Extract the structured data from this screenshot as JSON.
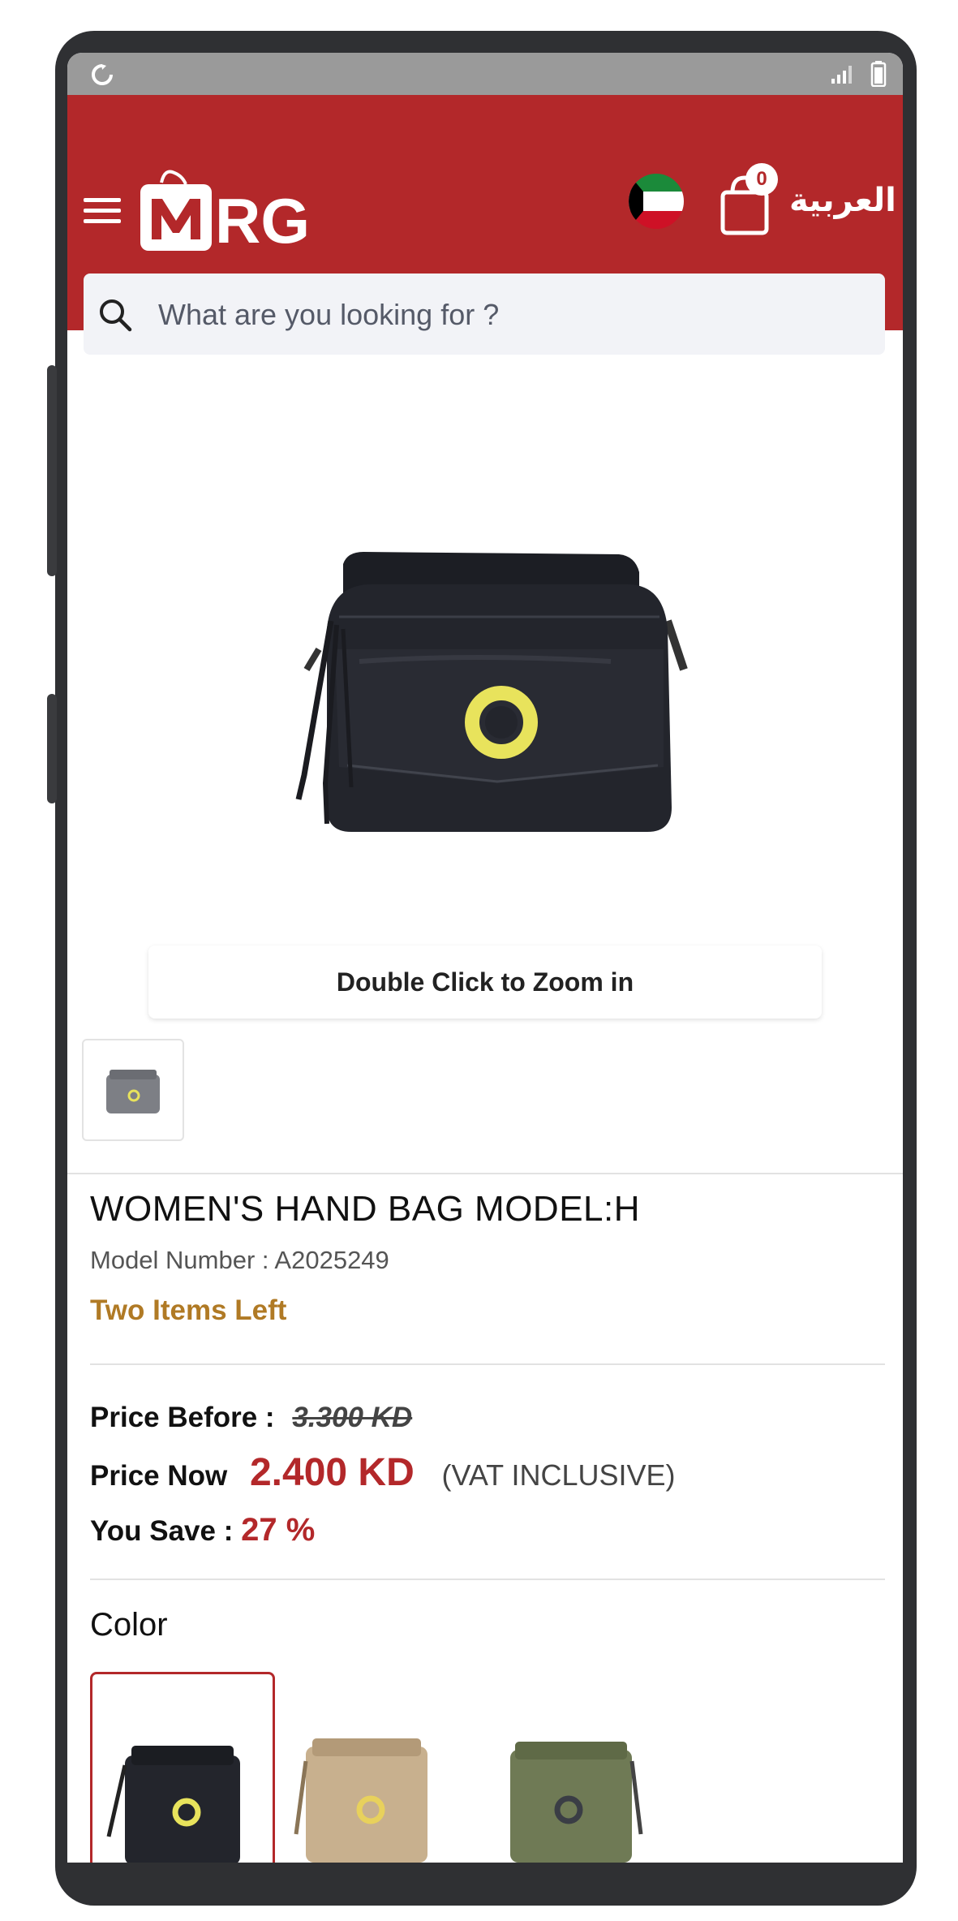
{
  "header": {
    "brand": "MRG",
    "cart_count": "0",
    "language_label": "العربية"
  },
  "search": {
    "placeholder": "What are you looking for ?"
  },
  "gallery": {
    "zoom_hint": "Double Click to Zoom in"
  },
  "product": {
    "title": "WOMEN'S HAND BAG MODEL:H",
    "model_number": "Model Number : A2025249",
    "stock_status": "Two Items Left",
    "price_before_label": "Price Before :",
    "price_before_value": "3.300 KD",
    "price_now_label": "Price Now",
    "price_now_value": "2.400 KD",
    "vat_note": "(VAT INCLUSIVE)",
    "you_save_label": "You Save :",
    "you_save_value": "27 %"
  },
  "colors": {
    "title": "Color",
    "swatches": [
      "black",
      "beige",
      "olive-green"
    ]
  },
  "theme": {
    "brand_red": "#b3282a",
    "stock_gold": "#b07a25"
  }
}
